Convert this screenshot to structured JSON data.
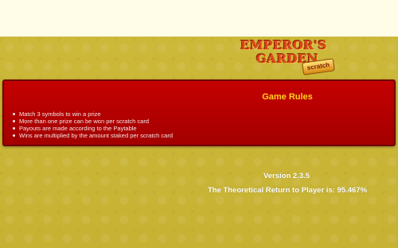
{
  "logo": {
    "line1": "EMPEROR'S",
    "line2": "GARDEN",
    "badge": "scratch"
  },
  "rules": {
    "title": "Game Rules",
    "items": [
      "Match 3 symbols to win a prize",
      "More than one prize can be won per scratch card",
      "Payouts are made according to the Paytable",
      "Wins are multiplied by the amount staked per scratch card"
    ]
  },
  "footer": {
    "version": "Version 2.3.5",
    "rtp": "The Theoretical Return to Player is: 95.467%"
  },
  "colors": {
    "background": "#c9b535",
    "panel": "#b80000",
    "title": "#ffd21a",
    "logo": "#e0451d"
  }
}
